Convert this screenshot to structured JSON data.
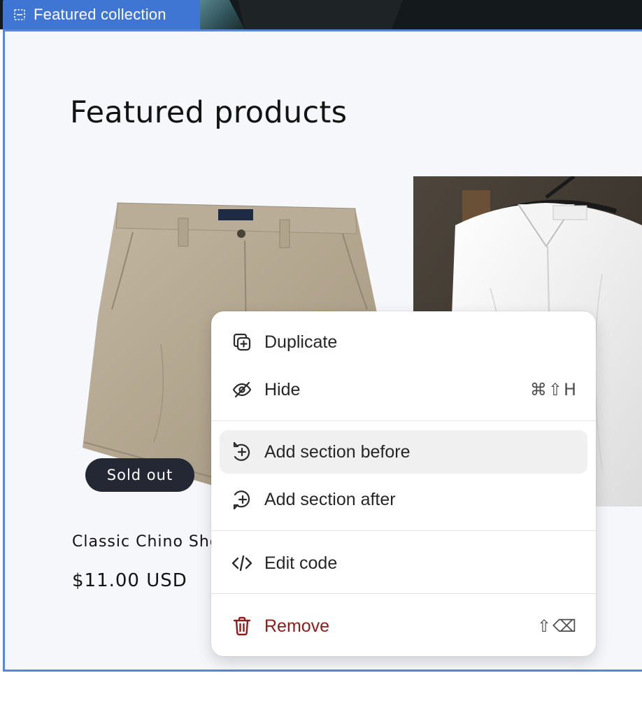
{
  "editor": {
    "section_tab_label": "Featured collection"
  },
  "section": {
    "heading": "Featured products",
    "products": [
      {
        "title": "Classic Chino Shorts",
        "price": "$11.00 USD",
        "badge": "Sold out",
        "image": "khaki-chino-shorts"
      },
      {
        "title": "",
        "price": "",
        "image": "white-linen-shirt"
      }
    ]
  },
  "context_menu": {
    "items": [
      {
        "label": "Duplicate",
        "icon": "duplicate-icon",
        "shortcut": ""
      },
      {
        "label": "Hide",
        "icon": "eye-off-icon",
        "shortcut": "⌘⇧H"
      },
      {
        "label": "Add section before",
        "icon": "add-section-before-icon",
        "shortcut": "",
        "highlighted": true
      },
      {
        "label": "Add section after",
        "icon": "add-section-after-icon",
        "shortcut": ""
      },
      {
        "label": "Edit code",
        "icon": "code-icon",
        "shortcut": ""
      },
      {
        "label": "Remove",
        "icon": "trash-icon",
        "shortcut": "⇧⌫",
        "danger": true
      }
    ]
  },
  "colors": {
    "editor_accent": "#3f76d4",
    "section_background": "#f6f7fb",
    "badge_background": "#232834",
    "danger": "#8c1d1a",
    "highlight": "#f0f0f0"
  }
}
